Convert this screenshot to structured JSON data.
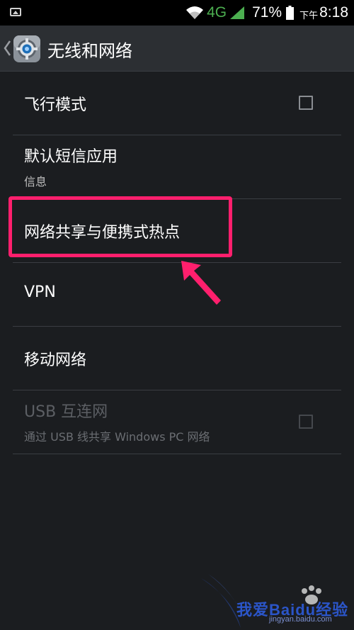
{
  "status_bar": {
    "network": "4G",
    "battery_percent": "71%",
    "time_prefix": "下午",
    "time": "8:18",
    "icons": [
      "image-notification-icon",
      "wifi-icon",
      "signal-icon",
      "battery-icon"
    ]
  },
  "action_bar": {
    "title": "无线和网络",
    "icon": "settings-gear-icon"
  },
  "settings": [
    {
      "title": "飞行模式",
      "has_checkbox": true,
      "checked": false
    },
    {
      "title": "默认短信应用",
      "subtitle": "信息"
    },
    {
      "title": "网络共享与便携式热点"
    },
    {
      "title": "VPN"
    },
    {
      "title": "移动网络"
    },
    {
      "title": "USB 互连网",
      "subtitle": "通过 USB 线共享 Windows PC 网络",
      "has_checkbox": true,
      "checked": false,
      "disabled": true
    }
  ],
  "annotation": {
    "highlight_color": "#ff1f6d"
  },
  "watermark": {
    "text": "我爱Baidu经验",
    "url": "jingyan.baidu.com"
  },
  "colors": {
    "background": "#1b1d20",
    "action_bar": "#2c2f33",
    "signal_green": "#4caf50"
  }
}
